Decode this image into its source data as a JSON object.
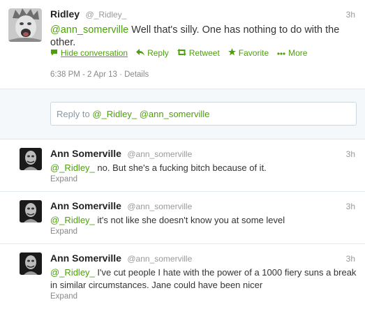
{
  "main_tweet": {
    "fullname": "Ridley",
    "screen_name": "@_Ridley_",
    "time": "3h",
    "mention": "@ann_somerville",
    "text": " Well that's silly. One has nothing to do with the other.",
    "actions": {
      "hide_conversation": "Hide conversation",
      "reply": "Reply",
      "retweet": "Retweet",
      "favorite": "Favorite",
      "more": "More"
    },
    "timestamp": "6:38 PM - 2 Apr 13",
    "details": "Details"
  },
  "reply_box": {
    "prefix": "Reply to ",
    "mentions": "@_Ridley_ @ann_somerville"
  },
  "replies": [
    {
      "fullname": "Ann Somerville",
      "screen_name": "@ann_somerville",
      "time": "3h",
      "mention": "@_Ridley_",
      "text": " no. But she's a fucking bitch because of it.",
      "expand": "Expand"
    },
    {
      "fullname": "Ann Somerville",
      "screen_name": "@ann_somerville",
      "time": "3h",
      "mention": "@_Ridley_",
      "text": " it's not like she doesn't know you at some level",
      "expand": "Expand"
    },
    {
      "fullname": "Ann Somerville",
      "screen_name": "@ann_somerville",
      "time": "3h",
      "mention": "@_Ridley_",
      "text": " I've cut people I hate with the power of a 1000 fiery suns a break in similar circumstances. Jane could have been nicer",
      "expand": "Expand"
    }
  ],
  "colors": {
    "link_green": "#4d9f0c",
    "meta_gray": "#888888",
    "border": "#e1e8ed",
    "reply_bg": "#f5f8fa"
  },
  "icons": {
    "hide": "speech-bubble-icon",
    "reply": "reply-arrow-icon",
    "retweet": "retweet-icon",
    "favorite": "star-icon",
    "more": "dots-icon"
  }
}
